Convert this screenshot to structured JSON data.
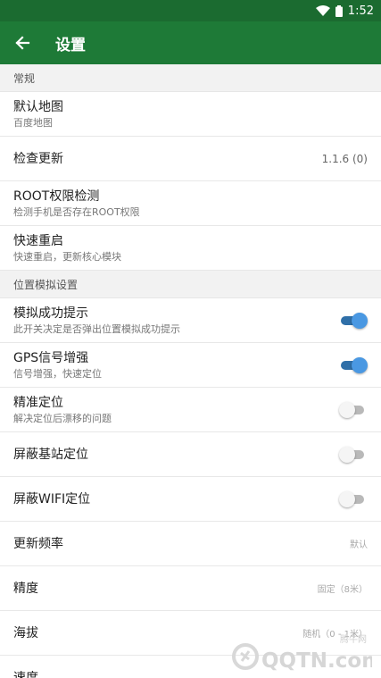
{
  "status_bar": {
    "time": "1:52"
  },
  "app_bar": {
    "title": "设置",
    "back_icon": "arrow-left-icon"
  },
  "sections": [
    {
      "header": "常规",
      "items": [
        {
          "title": "默认地图",
          "subtitle": "百度地图"
        },
        {
          "title": "检查更新",
          "value": "1.1.6 (0)"
        },
        {
          "title": "ROOT权限检测",
          "subtitle": "检测手机是否存在ROOT权限"
        },
        {
          "title": "快速重启",
          "subtitle": "快速重启，更新核心模块"
        }
      ]
    },
    {
      "header": "位置模拟设置",
      "items": [
        {
          "title": "模拟成功提示",
          "subtitle": "此开关决定是否弹出位置模拟成功提示",
          "switch_on": true
        },
        {
          "title": "GPS信号增强",
          "subtitle": "信号增强，快速定位",
          "switch_on": true
        },
        {
          "title": "精准定位",
          "subtitle": "解决定位后漂移的问题",
          "switch_on": false
        },
        {
          "title": "屏蔽基站定位",
          "switch_on": false
        },
        {
          "title": "屏蔽WIFI定位",
          "switch_on": false
        },
        {
          "title": "更新频率",
          "value": "默认"
        },
        {
          "title": "精度",
          "value": "固定（8米）"
        },
        {
          "title": "海拔",
          "value": "随机（0 - 1米）"
        },
        {
          "title": "速度",
          "value": ""
        }
      ]
    }
  ],
  "watermark": {
    "brand": "QQTN.com",
    "sub": "腾牛网"
  },
  "colors": {
    "status_bar": "#1b6b30",
    "app_bar": "#1e7a37",
    "switch_on_thumb": "#4a98e2",
    "switch_on_track": "#2f6fa8",
    "switch_off_thumb": "#f5f5f5",
    "switch_off_track": "#b9b9b9"
  }
}
